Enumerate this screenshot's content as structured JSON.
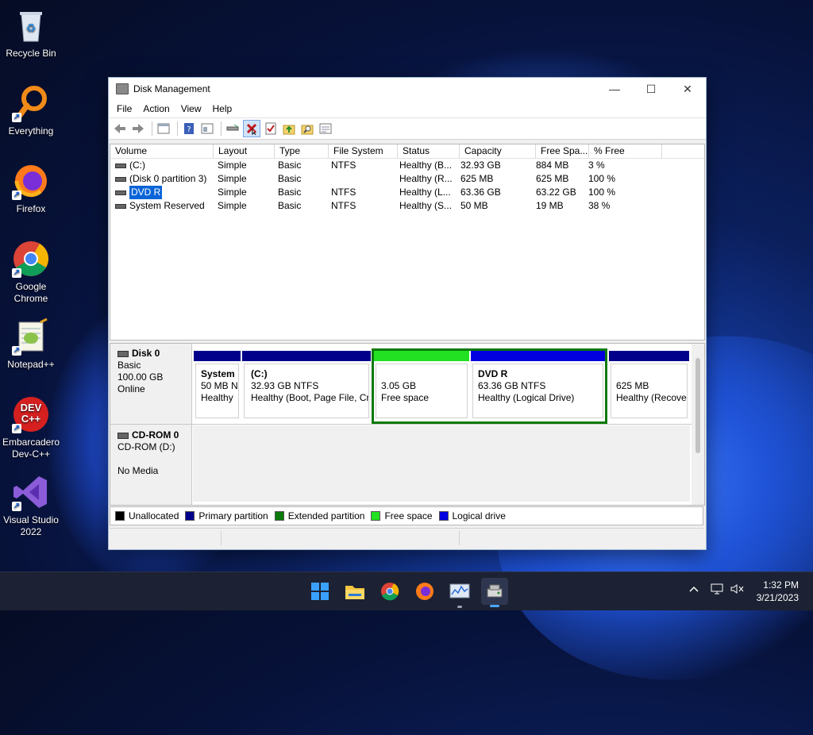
{
  "desktop": {
    "icons": [
      {
        "label": "Recycle Bin",
        "icon": "recycle-bin-icon"
      },
      {
        "label": "Everything",
        "icon": "everything-search-icon"
      },
      {
        "label": "Firefox",
        "icon": "firefox-icon"
      },
      {
        "label": "Google Chrome",
        "icon": "chrome-icon"
      },
      {
        "label": "Notepad++",
        "icon": "notepad-plus-plus-icon"
      },
      {
        "label": "Embarcadero Dev-C++",
        "icon": "devcpp-icon"
      },
      {
        "label": "Visual Studio 2022",
        "icon": "visual-studio-icon"
      }
    ],
    "devcpp_icon_text": "DEV C++"
  },
  "window": {
    "title": "Disk Management",
    "menu": [
      "File",
      "Action",
      "View",
      "Help"
    ],
    "controls": {
      "minimize": "—",
      "maximize": "☐",
      "close": "✕"
    }
  },
  "toolbar": {
    "icons": [
      "back-icon",
      "forward-icon",
      "show-pane-icon",
      "help-icon",
      "console-icon",
      "connect-icon",
      "delete-icon",
      "check-icon",
      "folder-up-icon",
      "search-icon",
      "properties-icon"
    ]
  },
  "volume_table": {
    "columns": [
      "Volume",
      "Layout",
      "Type",
      "File System",
      "Status",
      "Capacity",
      "Free Spa...",
      "% Free"
    ],
    "rows": [
      {
        "volume": "(C:)",
        "layout": "Simple",
        "type": "Basic",
        "fs": "NTFS",
        "status": "Healthy (B...",
        "capacity": "32.93 GB",
        "free": "884 MB",
        "pct": "3 %"
      },
      {
        "volume": "(Disk 0 partition 3)",
        "layout": "Simple",
        "type": "Basic",
        "fs": "",
        "status": "Healthy (R...",
        "capacity": "625 MB",
        "free": "625 MB",
        "pct": "100 %"
      },
      {
        "volume": "DVD R",
        "layout": "Simple",
        "type": "Basic",
        "fs": "NTFS",
        "status": "Healthy (L...",
        "capacity": "63.36 GB",
        "free": "63.22 GB",
        "pct": "100 %"
      },
      {
        "volume": "System Reserved",
        "layout": "Simple",
        "type": "Basic",
        "fs": "NTFS",
        "status": "Healthy (S...",
        "capacity": "50 MB",
        "free": "19 MB",
        "pct": "38 %"
      }
    ],
    "selected_row": "DVD R"
  },
  "disks": {
    "disk0": {
      "name": "Disk 0",
      "type": "Basic",
      "size": "100.00 GB",
      "state": "Online",
      "partitions": [
        {
          "name": "System",
          "line2": "50 MB N",
          "line3": "Healthy",
          "bar_color": "#00008b"
        },
        {
          "name": "(C:)",
          "line2": "32.93 GB NTFS",
          "line3": "Healthy (Boot, Page File, Cra",
          "bar_color": "#00008b"
        },
        {
          "name": "",
          "line2": "3.05 GB",
          "line3": "Free space",
          "bar_color": "#22e022"
        },
        {
          "name": "DVD R",
          "line2": "63.36 GB NTFS",
          "line3": "Healthy (Logical Drive)",
          "bar_color": "#0000e0"
        },
        {
          "name": "",
          "line2": "625 MB",
          "line3": "Healthy (Recove",
          "bar_color": "#00008b"
        }
      ],
      "extended_border_color": "#0b7a0b"
    },
    "cdrom0": {
      "name": "CD-ROM 0",
      "drive": "CD-ROM (D:)",
      "media": "No Media"
    }
  },
  "legend": [
    {
      "label": "Unallocated",
      "color": "#000000"
    },
    {
      "label": "Primary partition",
      "color": "#00008b"
    },
    {
      "label": "Extended partition",
      "color": "#0b7a0b"
    },
    {
      "label": "Free space",
      "color": "#22e022"
    },
    {
      "label": "Logical drive",
      "color": "#0000e0"
    }
  ],
  "taskbar": {
    "apps": [
      "start-icon",
      "file-explorer-icon",
      "chrome-icon",
      "firefox-icon",
      "resource-monitor-icon",
      "disk-management-icon"
    ],
    "tray": [
      "chevron-up-icon",
      "network-icon",
      "volume-muted-icon"
    ],
    "time": "1:32 PM",
    "date": "3/21/2023"
  }
}
